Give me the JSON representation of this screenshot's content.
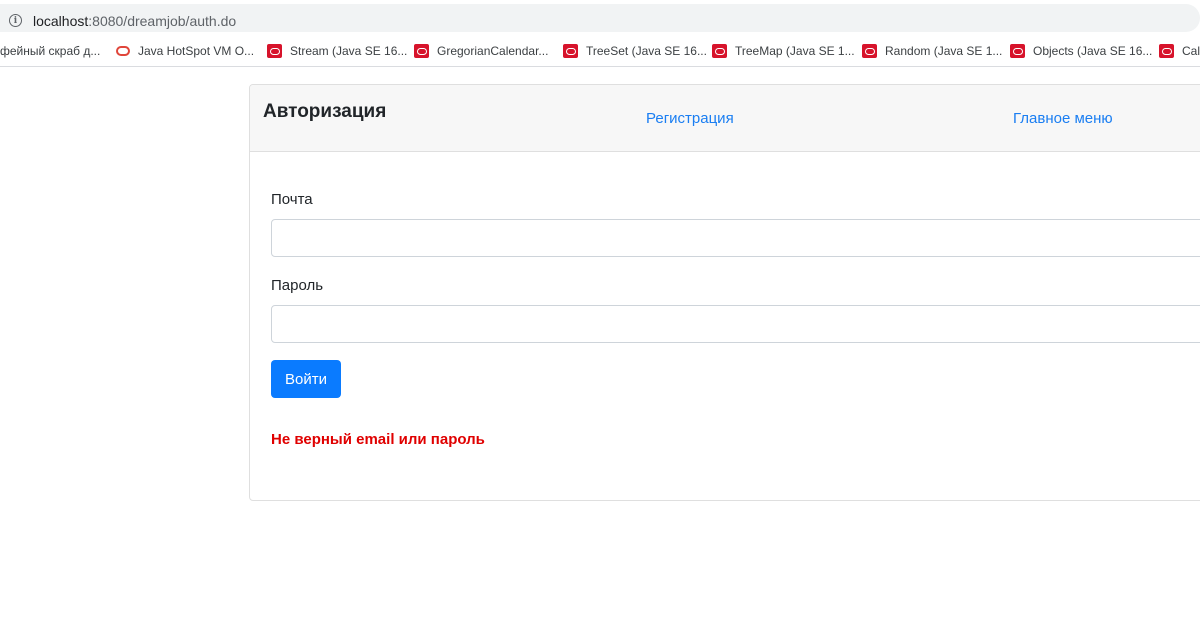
{
  "browser": {
    "url_host": "localhost",
    "url_rest": ":8080/dreamjob/auth.do",
    "bookmarks": [
      {
        "label": "фейный скраб д...",
        "icon": "none"
      },
      {
        "label": "Java HotSpot VM O...",
        "icon": "oracle-ring-icon"
      },
      {
        "label": "Stream (Java SE 16...",
        "icon": "oracle-icon"
      },
      {
        "label": "GregorianCalendar...",
        "icon": "oracle-icon"
      },
      {
        "label": "TreeSet (Java SE 16...",
        "icon": "oracle-icon"
      },
      {
        "label": "TreeMap (Java SE 1...",
        "icon": "oracle-icon"
      },
      {
        "label": "Random (Java SE 1...",
        "icon": "oracle-icon"
      },
      {
        "label": "Objects (Java SE 16...",
        "icon": "oracle-icon"
      },
      {
        "label": "Cal",
        "icon": "oracle-icon"
      }
    ]
  },
  "header": {
    "title": "Авторизация",
    "nav": {
      "register": "Регистрация",
      "main_menu": "Главное меню"
    }
  },
  "form": {
    "email_label": "Почта",
    "email_value": "",
    "password_label": "Пароль",
    "password_value": "",
    "submit_label": "Войти",
    "error_message": "Не верный email или пароль"
  },
  "colors": {
    "accent": "#0a7bff",
    "link": "#1a7ef2",
    "error": "#e00000"
  }
}
